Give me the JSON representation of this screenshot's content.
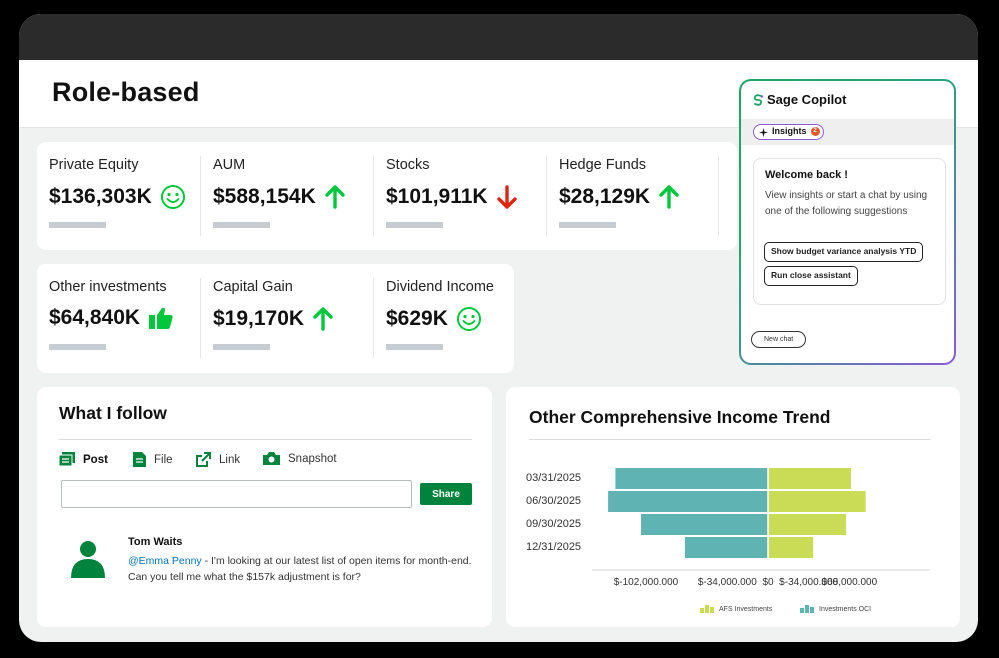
{
  "page": {
    "title": "Role-based"
  },
  "kpis_row1": [
    {
      "label": "Private Equity",
      "value": "$136,303K",
      "icon": "smiley-icon"
    },
    {
      "label": "AUM",
      "value": "$588,154K",
      "icon": "arrow-up-icon"
    },
    {
      "label": "Stocks",
      "value": "$101,911K",
      "icon": "arrow-down-icon"
    },
    {
      "label": "Hedge Funds",
      "value": "$28,129K",
      "icon": "arrow-up-icon"
    }
  ],
  "kpis_row2": [
    {
      "label": "Other investments",
      "value": "$64,840K",
      "icon": "thumbs-up-icon"
    },
    {
      "label": "Capital Gain",
      "value": "$19,170K",
      "icon": "arrow-up-icon"
    },
    {
      "label": "Dividend Income",
      "value": "$629K",
      "icon": "smiley-icon"
    }
  ],
  "colors": {
    "green": "#00c73c",
    "red": "#e0250f",
    "brand": "#00843d",
    "teal": "#5fb3b3",
    "lime": "#cadc55"
  },
  "follow": {
    "title": "What I follow",
    "tabs": [
      "Post",
      "File",
      "Link",
      "Snapshot"
    ],
    "share_label": "Share",
    "post": {
      "author": "Tom Waits",
      "mention": "@Emma Penny",
      "text": " - I'm looking at our latest list of open items for month-end. Can you tell me what the $157k adjustment is for?"
    }
  },
  "oci": {
    "title": "Other Comprehensive Income Trend"
  },
  "chart_data": {
    "type": "bar",
    "orientation": "horizontal",
    "stacked": "diverging",
    "categories": [
      "03/31/2025",
      "06/30/2025",
      "09/30/2025",
      "12/31/2025"
    ],
    "series": [
      {
        "name": "AFS Investments",
        "color": "#cadc55",
        "values": [
          68000000,
          80000000,
          64000000,
          37000000
        ]
      },
      {
        "name": "Investments OCI",
        "color": "#5fb3b3",
        "values": [
          -125000000,
          -131000000,
          -104000000,
          -68000000
        ]
      }
    ],
    "x_tick_labels": [
      "$-102,000.000",
      "$-34,000.000",
      "$0",
      "$-34,000.000",
      "$68,000.000"
    ],
    "x_ticks": [
      -102000000,
      -34000000,
      0,
      34000000,
      68000000
    ],
    "xlim": [
      -136000000,
      136000000
    ],
    "legend_position": "bottom"
  },
  "copilot": {
    "title": "Sage Copilot",
    "insights_label": "Insights",
    "insights_count": "2",
    "welcome_title": "Welcome back !",
    "welcome_text": "View insights or start a chat by using one of the following suggestions",
    "suggestions": [
      "Show budget variance analysis YTD",
      "Run close assistant"
    ],
    "new_chat_label": "New chat"
  }
}
